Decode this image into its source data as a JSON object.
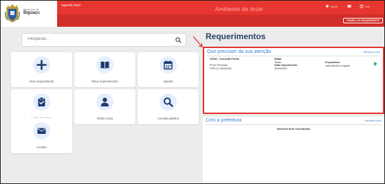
{
  "header": {
    "municipality_label": "Município de",
    "city": "Biguaçu",
    "app_name": "Agenda Fácil",
    "environment": "Ambiente de teste",
    "links": [
      "Ajuda",
      "Sair"
    ],
    "painel_button": "PAINEL DO REQUERENTE"
  },
  "search": {
    "placeholder": "Pesquisar..."
  },
  "tiles": [
    {
      "label": "Novo requerimento",
      "icon": "plus-icon"
    },
    {
      "label": "Meus requerimentos",
      "icon": "book-icon"
    },
    {
      "label": "Agenda",
      "icon": "calendar-icon"
    },
    {
      "label": "Aceite de termos",
      "icon": "clipboard-check-icon"
    },
    {
      "label": "Minha conta",
      "icon": "user-icon"
    },
    {
      "label": "Consulta pública",
      "icon": "search-icon"
    },
    {
      "label": "Contato",
      "icon": "envelope-icon"
    }
  ],
  "requerimentos": {
    "title": "Requerimentos",
    "attention": {
      "title": "Que precisam da sua atenção",
      "link": "Visualizar todos",
      "item": {
        "name": "61630 - Consulta Prévia",
        "processo_label": "Nº de Processo",
        "processo_value": "CPR-21-00000318",
        "etapa_label": "Etapa",
        "etapa_value": "Taxas",
        "data_label": "Data requerimento",
        "data_value": "30/08/2022",
        "proprietario_label": "Proprietário",
        "proprietario_value": "Julia Moreira Lingeier"
      }
    },
    "prefeitura": {
      "title": "Com a prefeitura",
      "link": "Visualizar todos",
      "empty": "Nenhum item encontrado"
    }
  },
  "colors": {
    "brand_red": "#e7352f",
    "accent_blue": "#3b7fd1",
    "icon_navy": "#1f3a6e",
    "success_green": "#22b14c"
  }
}
